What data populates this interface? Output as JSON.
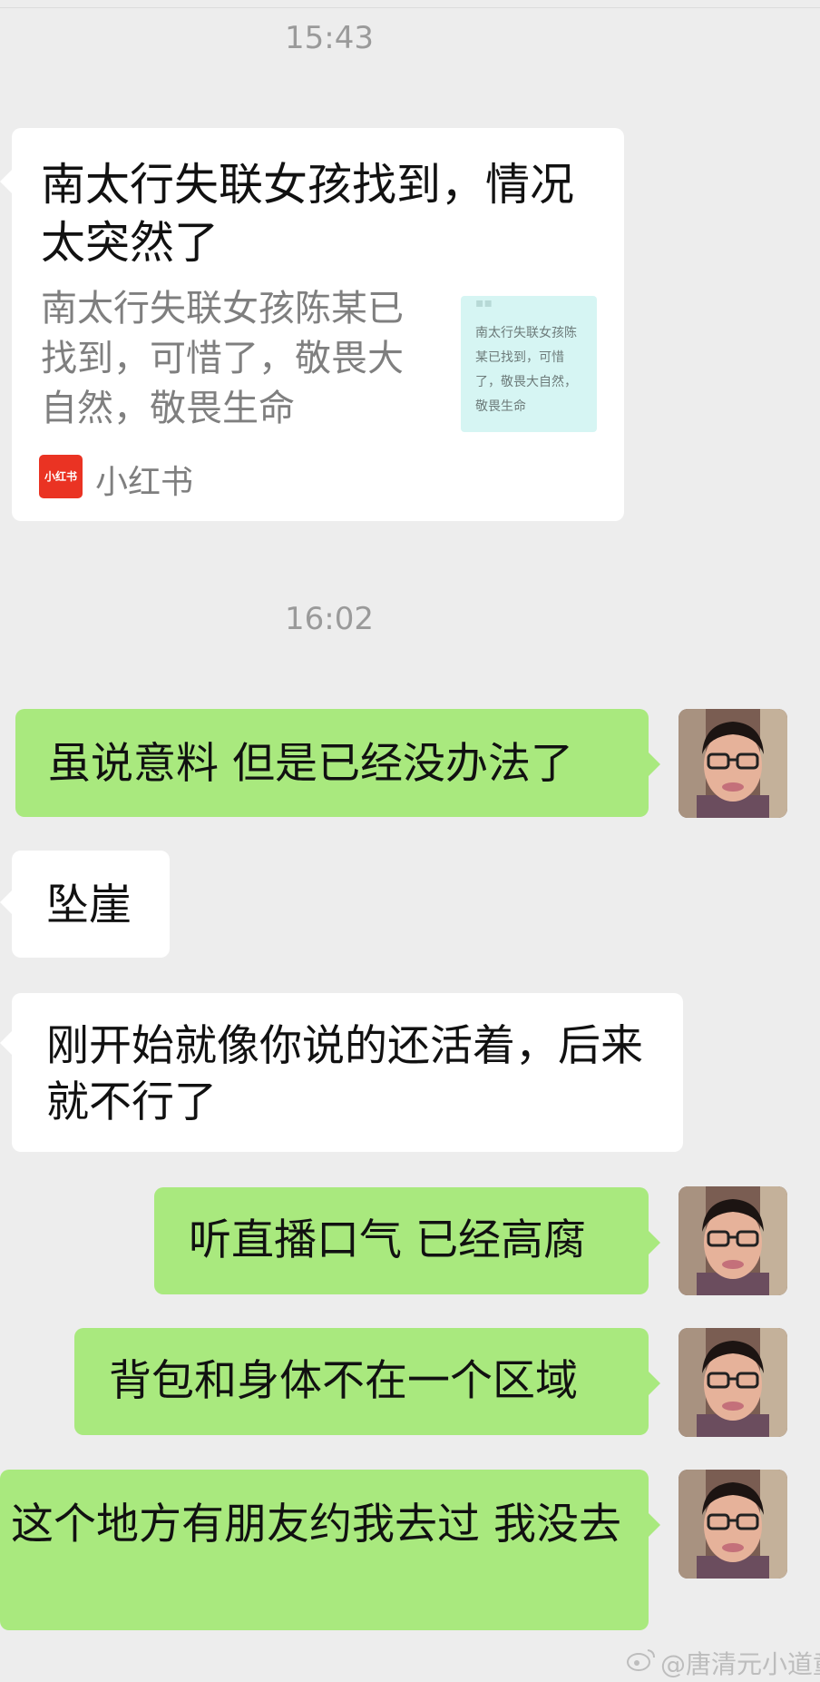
{
  "timestamps": [
    "15:43",
    "16:02"
  ],
  "link_card": {
    "title": "南太行失联女孩找到，情况太突然了",
    "description": "南太行失联女孩陈某已找到，可惜了，敬畏大自然，敬畏生命",
    "thumbnail_text": "南太行失联女孩陈某已找到，可惜了，敬畏大自然，敬畏生命",
    "source_icon_label": "小红书",
    "source_name": "小红书"
  },
  "messages": [
    {
      "side": "out",
      "text": "虽说意料 但是已经没办法了"
    },
    {
      "side": "in",
      "text": "坠崖"
    },
    {
      "side": "in",
      "text": "刚开始就像你说的还活着，后来就不行了"
    },
    {
      "side": "out",
      "text": "听直播口气 已经高腐"
    },
    {
      "side": "out",
      "text": "背包和身体不在一个区域"
    },
    {
      "side": "out",
      "text": "这个地方有朋友约我去过 我没去"
    }
  ],
  "watermark": "@唐清元小道童",
  "colors": {
    "background": "#ededed",
    "incoming_bubble": "#ffffff",
    "outgoing_bubble": "#a9e97e",
    "timestamp": "#9a9a9a",
    "source_icon": "#ea3323"
  }
}
